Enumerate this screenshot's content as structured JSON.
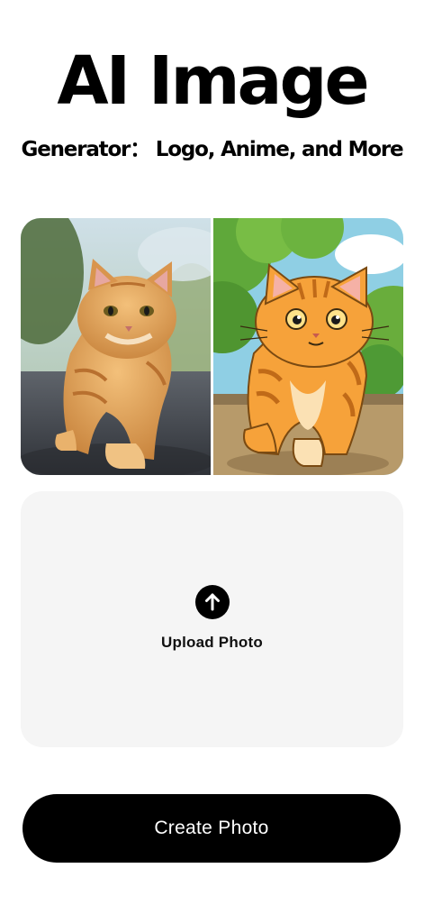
{
  "header": {
    "title": "AI Image",
    "subtitle": "Generator： Logo, Anime, and More"
  },
  "preview": {
    "before_icon": "photo-cat-icon",
    "after_icon": "anime-cat-icon"
  },
  "upload": {
    "icon": "arrow-up-icon",
    "label": "Upload Photo"
  },
  "actions": {
    "create_label": "Create Photo"
  },
  "colors": {
    "background": "#ffffff",
    "upload_panel": "#f5f5f5",
    "primary_button": "#000000",
    "primary_button_text": "#ffffff"
  }
}
